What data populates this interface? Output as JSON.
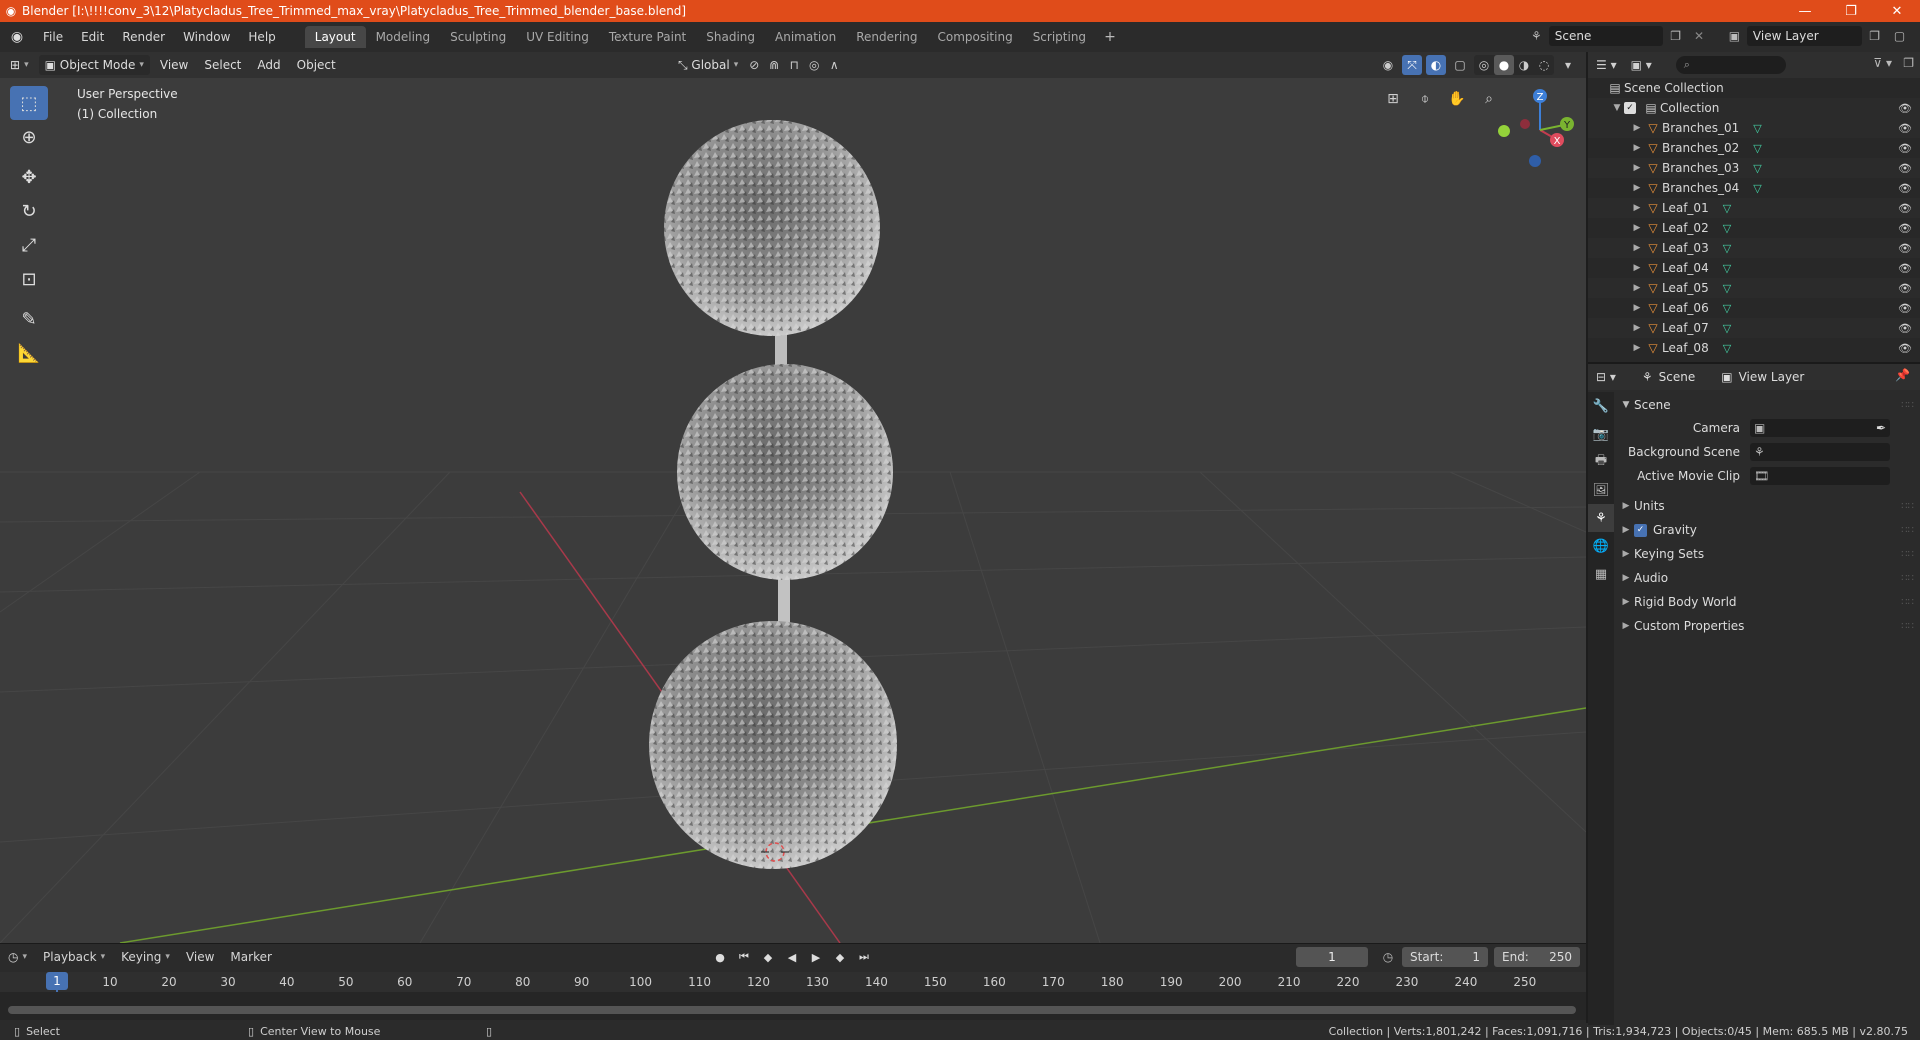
{
  "window": {
    "title": "Blender [I:\\!!!!conv_3\\12\\Platycladus_Tree_Trimmed_max_vray\\Platycladus_Tree_Trimmed_blender_base.blend]",
    "controls": [
      "—",
      "❐",
      "✕"
    ]
  },
  "menu": [
    "File",
    "Edit",
    "Render",
    "Window",
    "Help"
  ],
  "workspaces": [
    {
      "label": "Layout",
      "active": true
    },
    {
      "label": "Modeling"
    },
    {
      "label": "Sculpting"
    },
    {
      "label": "UV Editing"
    },
    {
      "label": "Texture Paint"
    },
    {
      "label": "Shading"
    },
    {
      "label": "Animation"
    },
    {
      "label": "Rendering"
    },
    {
      "label": "Compositing"
    },
    {
      "label": "Scripting"
    }
  ],
  "scene_selector": {
    "value": "Scene"
  },
  "view_layer_selector": {
    "value": "View Layer"
  },
  "viewport": {
    "mode": "Object Mode",
    "menus": [
      "View",
      "Select",
      "Add",
      "Object"
    ],
    "orientation": "Global",
    "info_line1": "User Perspective",
    "info_line2": "(1) Collection",
    "gizmo_axes": [
      "Z",
      "Y",
      "X"
    ]
  },
  "timeline": {
    "menus": [
      "Playback",
      "Keying",
      "View",
      "Marker"
    ],
    "current_frame": "1",
    "start_label": "Start:",
    "start_value": "1",
    "end_label": "End:",
    "end_value": "250",
    "ticks": [
      "1",
      "10",
      "20",
      "30",
      "40",
      "50",
      "60",
      "70",
      "80",
      "90",
      "100",
      "110",
      "120",
      "130",
      "140",
      "150",
      "160",
      "170",
      "180",
      "190",
      "200",
      "210",
      "220",
      "230",
      "240",
      "250"
    ]
  },
  "statusbar": {
    "select": "Select",
    "center_view": "Center View to Mouse",
    "stats": "Collection | Verts:1,801,242 | Faces:1,091,716 | Tris:1,934,723 | Objects:0/45 | Mem: 685.5 MB | v2.80.75"
  },
  "outliner": {
    "root": "Scene Collection",
    "collection": "Collection",
    "objects": [
      "Branches_01",
      "Branches_02",
      "Branches_03",
      "Branches_04",
      "Leaf_01",
      "Leaf_02",
      "Leaf_03",
      "Leaf_04",
      "Leaf_05",
      "Leaf_06",
      "Leaf_07",
      "Leaf_08"
    ]
  },
  "properties": {
    "tab_scene": "Scene",
    "tab_view_layer": "View Layer",
    "panel_scene": "Scene",
    "camera_label": "Camera",
    "background_scene_label": "Background Scene",
    "active_movie_clip_label": "Active Movie Clip",
    "subpanels": {
      "units": "Units",
      "gravity": "Gravity",
      "keying_sets": "Keying Sets",
      "audio": "Audio",
      "rigid_body_world": "Rigid Body World",
      "custom_properties": "Custom Properties"
    }
  },
  "colors": {
    "title_bar": "#e04c1a",
    "accent_blue": "#4772b3",
    "object_orange": "#e8913a",
    "mesh_green": "#44d2a5",
    "axis_red": "#a8394a",
    "axis_green": "#6c9a2e"
  }
}
